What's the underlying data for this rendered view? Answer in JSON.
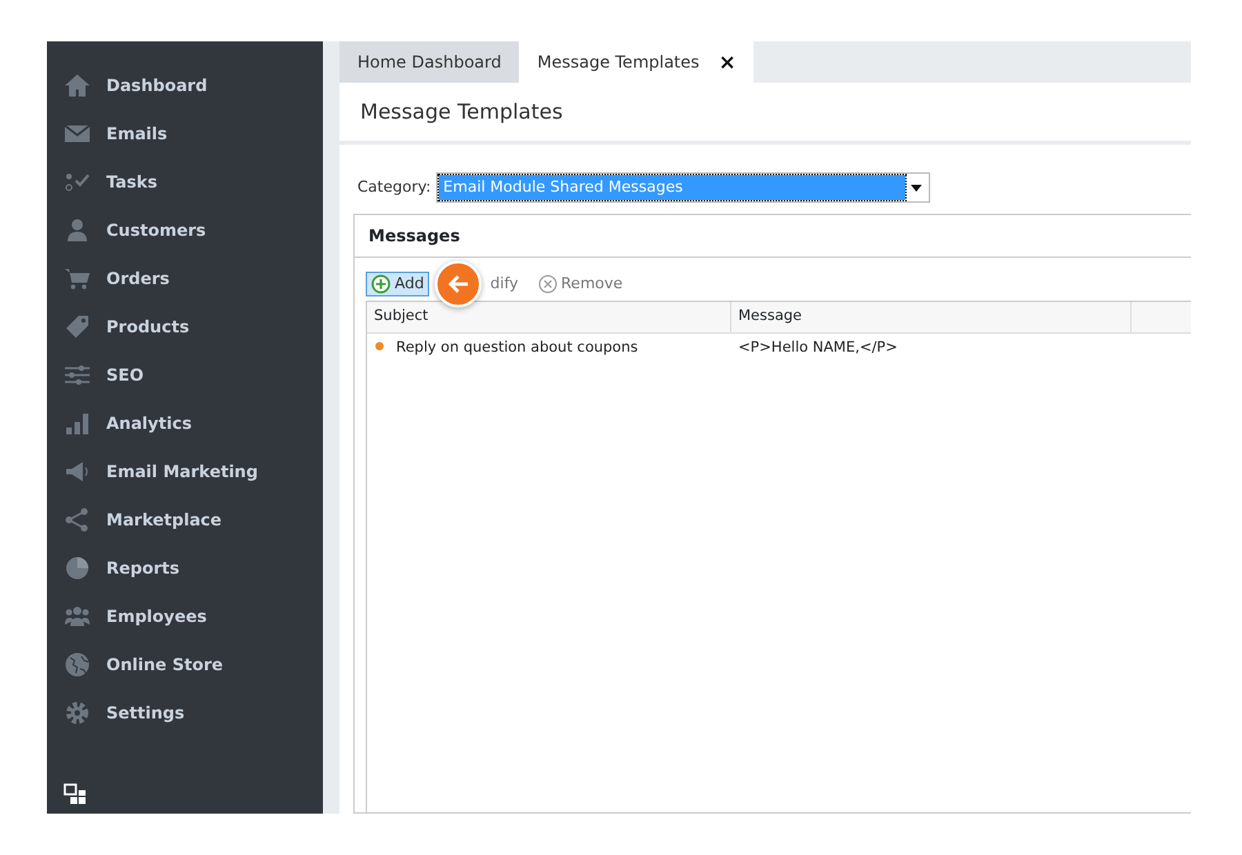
{
  "sidebar": {
    "items": [
      {
        "label": "Dashboard"
      },
      {
        "label": "Emails"
      },
      {
        "label": "Tasks"
      },
      {
        "label": "Customers"
      },
      {
        "label": "Orders"
      },
      {
        "label": "Products"
      },
      {
        "label": "SEO"
      },
      {
        "label": "Analytics"
      },
      {
        "label": "Email Marketing"
      },
      {
        "label": "Marketplace"
      },
      {
        "label": "Reports"
      },
      {
        "label": "Employees"
      },
      {
        "label": "Online Store"
      },
      {
        "label": "Settings"
      }
    ]
  },
  "tabs": [
    {
      "label": "Home Dashboard",
      "selected": false,
      "closable": false
    },
    {
      "label": "Message Templates",
      "selected": true,
      "closable": true,
      "close": "×"
    }
  ],
  "page_title": "Message Templates",
  "category": {
    "label": "Category:",
    "value": "Email Module Shared Messages",
    "focused": true
  },
  "messages": {
    "title": "Messages",
    "toolbar": [
      {
        "kind": "add",
        "label": "Add",
        "selected": true
      },
      {
        "kind": "modify",
        "label": "dify",
        "selected": false
      },
      {
        "kind": "remove",
        "label": "Remove",
        "selected": false
      }
    ],
    "columns": [
      "Subject",
      "Message"
    ],
    "rows": [
      {
        "color": "#f08a24",
        "subject": "Reply on question about coupons",
        "message": "<P>Hello NAME,</P>"
      }
    ]
  }
}
